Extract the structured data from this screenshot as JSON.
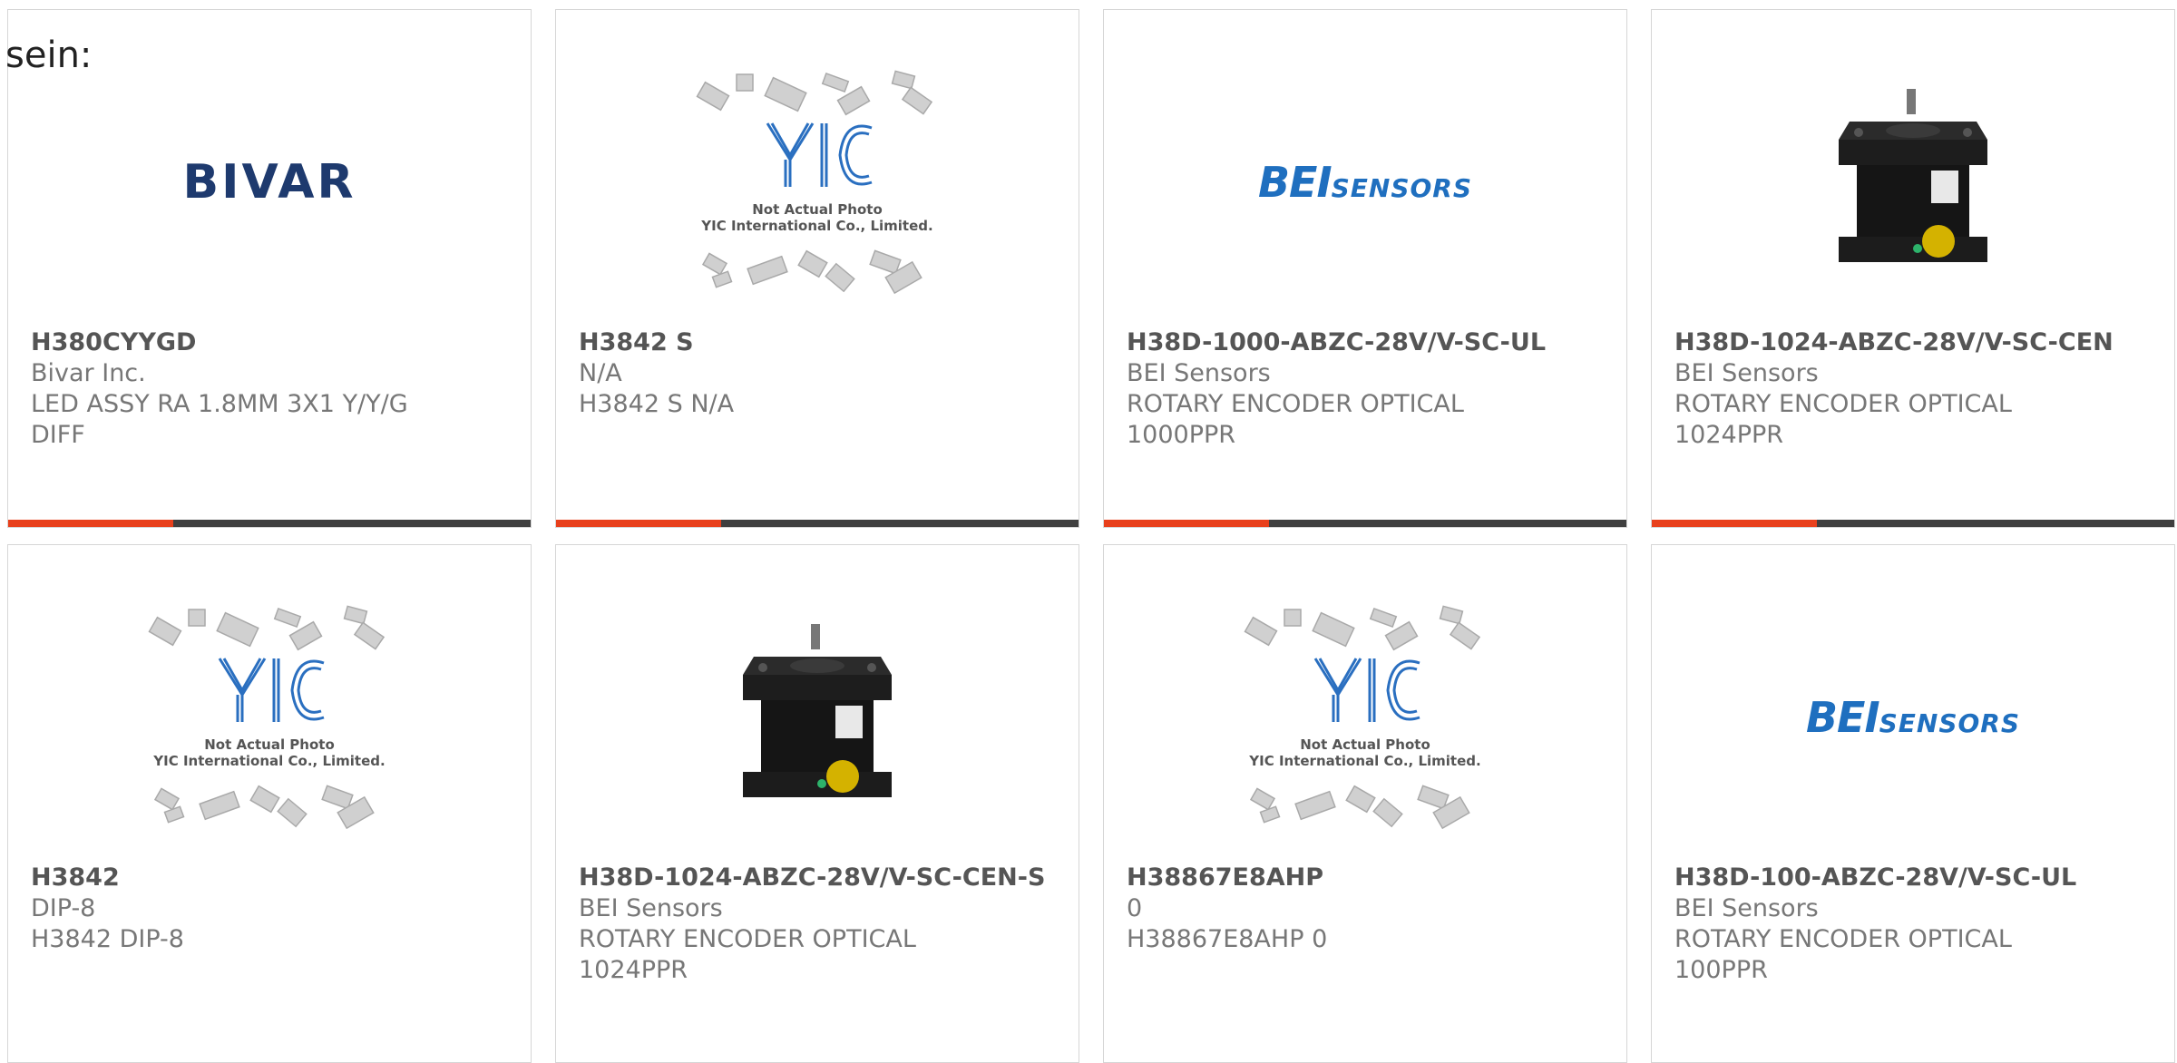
{
  "lead_text": "sein:",
  "colors": {
    "accent": "#e8401c",
    "bar": "#3f3f3f",
    "bivar_blue": "#1e3a6e",
    "bei_blue": "#1f6fbf",
    "yic_blue": "#2a6fc0"
  },
  "logo_text": {
    "bivar": "BIVAR",
    "bei_big": "BEI",
    "bei_small": "SENSORS",
    "yic_caption_1": "Not Actual Photo",
    "yic_caption_2": "YIC International Co., Limited."
  },
  "products": [
    {
      "part_number": "H380CYYGD",
      "manufacturer": "Bivar Inc.",
      "description": "LED ASSY RA 1.8MM 3X1 Y/Y/G",
      "description_2": "DIFF",
      "image": "bivar-logo"
    },
    {
      "part_number": "H3842 S",
      "manufacturer": "N/A",
      "description": "H3842 S N/A",
      "description_2": "",
      "image": "yic-placeholder"
    },
    {
      "part_number": "H38D-1000-ABZC-28V/V-SC-UL",
      "manufacturer": "BEI Sensors",
      "description": "ROTARY ENCODER OPTICAL",
      "description_2": "1000PPR",
      "image": "bei-logo"
    },
    {
      "part_number": "H38D-1024-ABZC-28V/V-SC-CEN",
      "manufacturer": "BEI Sensors",
      "description": "ROTARY ENCODER OPTICAL",
      "description_2": "1024PPR",
      "image": "encoder-photo"
    },
    {
      "part_number": "H3842",
      "manufacturer": "DIP-8",
      "description": "H3842 DIP-8",
      "description_2": "",
      "image": "yic-placeholder"
    },
    {
      "part_number": "H38D-1024-ABZC-28V/V-SC-CEN-S",
      "manufacturer": "BEI Sensors",
      "description": "ROTARY ENCODER OPTICAL",
      "description_2": "1024PPR",
      "image": "encoder-photo"
    },
    {
      "part_number": "H38867E8AHP",
      "manufacturer": "0",
      "description": "H38867E8AHP 0",
      "description_2": "",
      "image": "yic-placeholder"
    },
    {
      "part_number": "H38D-100-ABZC-28V/V-SC-UL",
      "manufacturer": "BEI Sensors",
      "description": "ROTARY ENCODER OPTICAL",
      "description_2": "100PPR",
      "image": "bei-logo"
    }
  ]
}
